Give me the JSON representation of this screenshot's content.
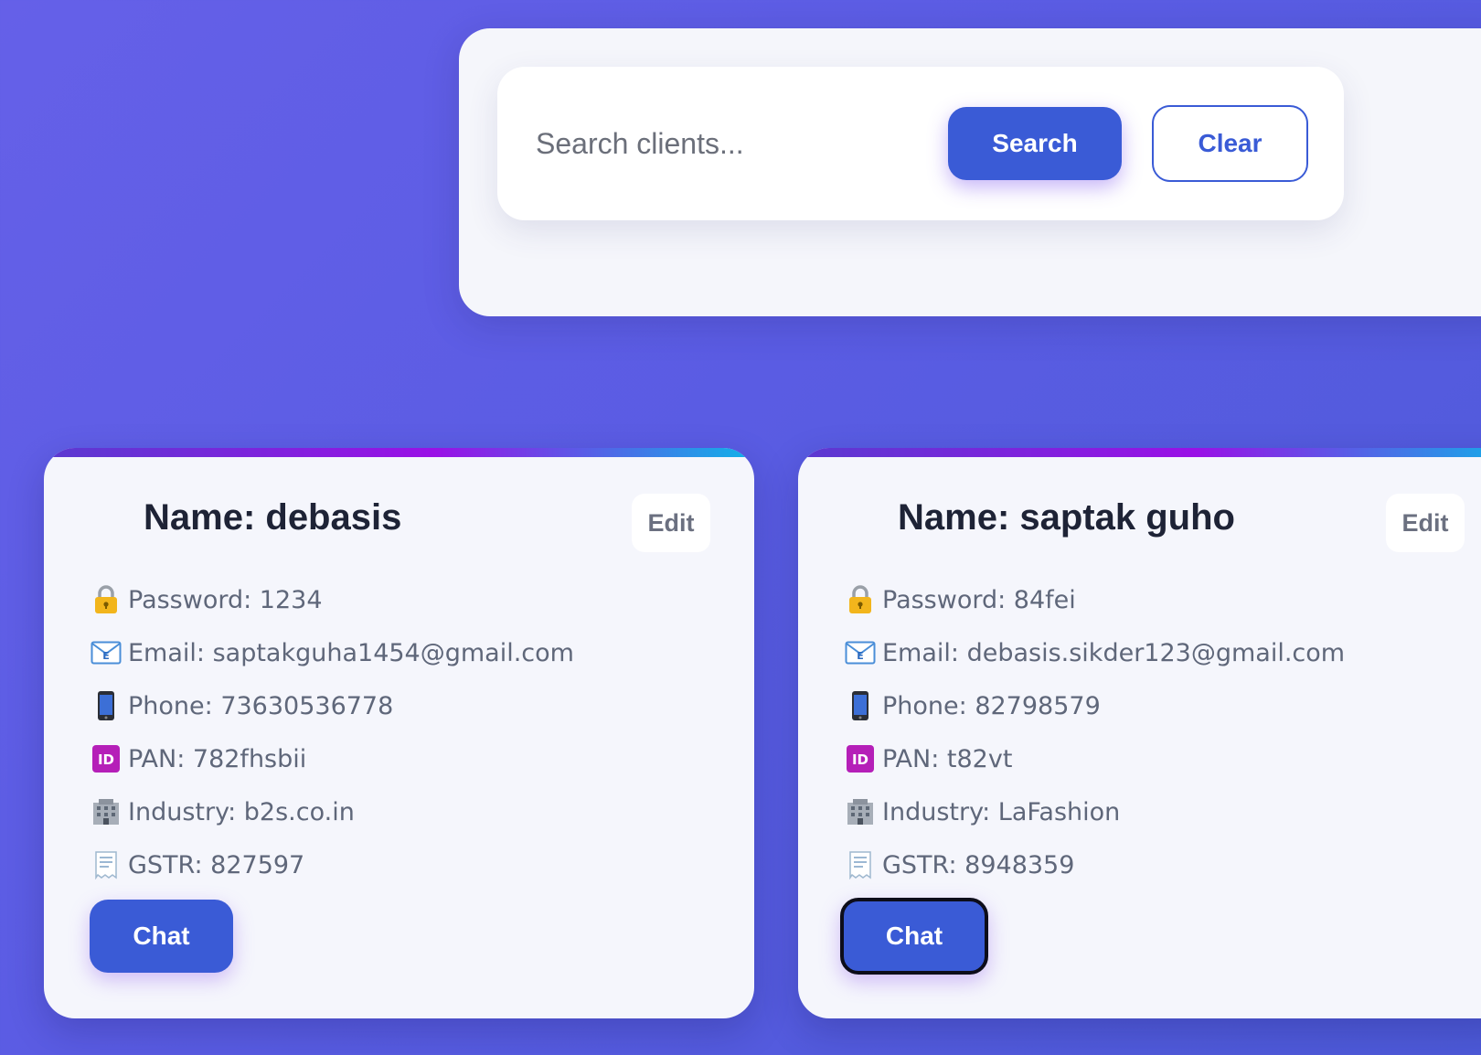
{
  "search": {
    "placeholder": "Search clients...",
    "search_label": "Search",
    "clear_label": "Clear"
  },
  "clients": [
    {
      "title": "Name: debasis",
      "edit_label": "Edit",
      "password": "Password: 1234",
      "email": "Email: saptakguha1454@gmail.com",
      "phone": "Phone: 73630536778",
      "pan": "PAN: 782fhsbii",
      "industry": "Industry: b2s.co.in",
      "gstr": "GSTR: 827597",
      "chat_label": "Chat"
    },
    {
      "title": "Name: saptak guho",
      "edit_label": "Edit",
      "password": "Password: 84fei",
      "email": "Email: debasis.sikder123@gmail.com",
      "phone": "Phone: 82798579",
      "pan": "PAN: t82vt",
      "industry": "Industry: LaFashion",
      "gstr": "GSTR: 8948359",
      "chat_label": "Chat"
    }
  ],
  "icons": {
    "password": "lock-icon",
    "email": "email-icon",
    "phone": "mobile-phone-icon",
    "pan": "id-icon",
    "industry": "office-building-icon",
    "gstr": "receipt-icon"
  },
  "colors": {
    "primary": "#3a5bd6",
    "title": "#1e2336",
    "detail_text": "#5f677a",
    "background_start": "#6560e8",
    "background_end": "#4d5ad8"
  }
}
